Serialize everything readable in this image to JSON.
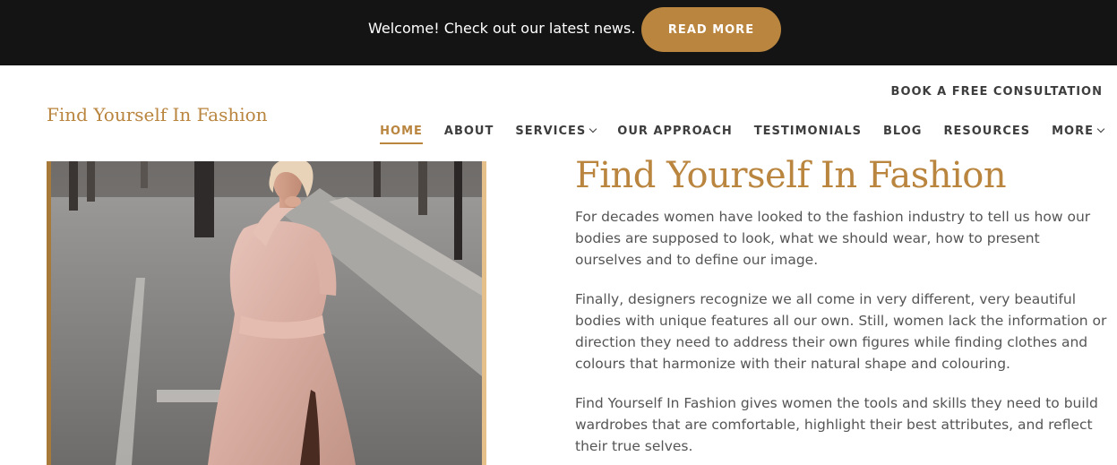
{
  "announcement": {
    "text": "Welcome! Check out our latest news.",
    "button_label": "READ MORE"
  },
  "header": {
    "brand": "Find Yourself In Fashion",
    "cta": "BOOK A FREE CONSULTATION",
    "nav": [
      {
        "label": "HOME",
        "active": true
      },
      {
        "label": "ABOUT"
      },
      {
        "label": "SERVICES",
        "dropdown": true
      },
      {
        "label": "OUR APPROACH"
      },
      {
        "label": "TESTIMONIALS"
      },
      {
        "label": "BLOG"
      },
      {
        "label": "RESOURCES"
      },
      {
        "label": "MORE",
        "dropdown": true
      }
    ]
  },
  "main": {
    "title": "Find Yourself In Fashion",
    "paragraphs": [
      "For decades women have looked to the fashion industry to tell us how our bodies are supposed to look, what we should wear, how to present ourselves and to define our image.",
      "Finally, designers recognize we all come in very different, very beautiful bodies with unique features all our own. Still, women lack the information or direction they need to address their own figures while finding clothes and colours that harmonize with their natural shape and colouring.",
      "Find Yourself In Fashion gives women the tools and skills they need to build wardrobes that are comfortable, highlight their best attributes, and reflect their true selves."
    ]
  },
  "colors": {
    "accent": "#b9853f",
    "topbar_bg": "#141414",
    "nav_text": "#3d3d3d",
    "body_text": "#555555"
  }
}
